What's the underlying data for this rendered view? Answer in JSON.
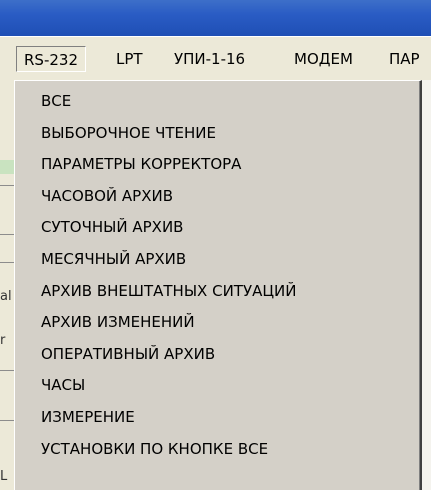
{
  "menubar": {
    "items": [
      {
        "label": "RS-232"
      },
      {
        "label": "LPT"
      },
      {
        "label": "УПИ-1-16"
      },
      {
        "label": "МОДЕМ"
      },
      {
        "label": "ПАР"
      }
    ]
  },
  "background_edge": {
    "glyph_1": "al",
    "glyph_2": "r",
    "glyph_3": "L"
  },
  "dropdown": {
    "items": [
      {
        "label": "ВСЕ"
      },
      {
        "label": "ВЫБОРОЧНОЕ ЧТЕНИЕ"
      },
      {
        "label": "ПАРАМЕТРЫ КОРРЕКТОРА"
      },
      {
        "label": "ЧАСОВОЙ АРХИВ"
      },
      {
        "label": "СУТОЧНЫЙ АРХИВ"
      },
      {
        "label": "МЕСЯЧНЫЙ АРХИВ"
      },
      {
        "label": "АРХИВ ВНЕШТАТНЫХ СИТУАЦИЙ"
      },
      {
        "label": "АРХИВ  ИЗМЕНЕНИЙ"
      },
      {
        "label": "ОПЕРАТИВНЫЙ АРХИВ"
      },
      {
        "label": "ЧАСЫ"
      },
      {
        "label": "ИЗМЕРЕНИЕ"
      },
      {
        "label": "УСТАНОВКИ ПО КНОПКЕ ВСЕ"
      }
    ]
  }
}
